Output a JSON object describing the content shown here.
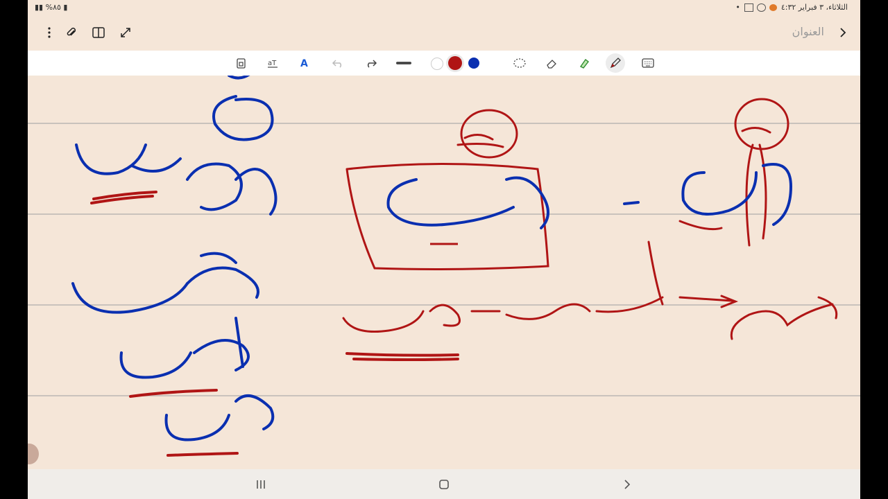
{
  "status_bar": {
    "battery": "%٨٥",
    "datetime": "الثلاثاء، ٣ فبراير  ٤:٣٢"
  },
  "header": {
    "title_placeholder": "العنوان",
    "icons": [
      "chevron-right-icon",
      "expand-icon",
      "split-view-icon",
      "attach-icon",
      "more-icon"
    ]
  },
  "toolbar": {
    "tools": [
      "insert-page-icon",
      "text-recognize-icon",
      "text-style-icon",
      "undo-icon",
      "redo-icon",
      "line-thickness-icon",
      "lasso-icon",
      "eraser-icon",
      "highlighter-icon",
      "pen-icon",
      "keyboard-icon"
    ],
    "selected_tool": "pen-icon",
    "colors": [
      "#ffffff",
      "#b01515",
      "#0a2fb0"
    ],
    "selected_color": "#b01515"
  },
  "nav": {
    "icons": [
      "recents-icon",
      "home-icon",
      "back-icon"
    ]
  }
}
